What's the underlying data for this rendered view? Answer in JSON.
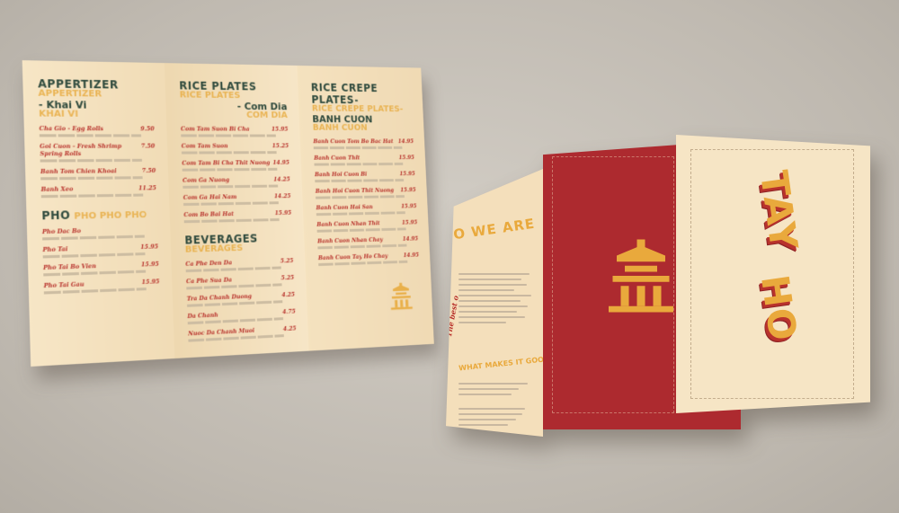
{
  "inside": {
    "panel1": {
      "heading": "APPERTIZER",
      "echo": "APPERTIZER",
      "subheading": "- Khai Vi",
      "sub_echo": "KHAI VI",
      "items": [
        {
          "name": "Cha Gio - Egg Rolls",
          "price": "9.50"
        },
        {
          "name": "Goi Cuon - Fresh Shrimp Spring Rolls",
          "price": "7.50"
        },
        {
          "name": "Banh Tom Chien Khoai",
          "price": "7.50"
        },
        {
          "name": "Banh Xeo",
          "price": "11.25"
        }
      ],
      "pho_heading": "PHO",
      "pho_echo": "PHO PHO PHO",
      "pho_items": [
        {
          "name": "Pho Dac Bo",
          "price": ""
        },
        {
          "name": "Pho Tai",
          "price": "15.95"
        },
        {
          "name": "Pho Tai Bo Vien",
          "price": "15.95"
        },
        {
          "name": "Pho Tai Gau",
          "price": "15.95"
        }
      ]
    },
    "panel2": {
      "heading": "RICE PLATES",
      "echo": "RICE PLATES",
      "subheading": "- Com Dia",
      "sub_echo": "COM DIA",
      "items": [
        {
          "name": "Com Tam Suon Bi Cha",
          "price": "15.95"
        },
        {
          "name": "Com Tam Suon",
          "price": "15.25"
        },
        {
          "name": "Com Tam Bi Cha Thit Nuong",
          "price": "14.95"
        },
        {
          "name": "Com Ga Nuong",
          "price": "14.25"
        },
        {
          "name": "Com Ga Hai Nam",
          "price": "14.25"
        },
        {
          "name": "Com Bo Bai Hat",
          "price": "15.95"
        }
      ],
      "bev_heading": "BEVERAGES",
      "bev_echo": "BEVERAGES",
      "bev_items": [
        {
          "name": "Ca Phe Den Da",
          "price": "5.25"
        },
        {
          "name": "Ca Phe Sua Da",
          "price": "5.25"
        },
        {
          "name": "Tra Da Chanh Duong",
          "price": "4.25"
        },
        {
          "name": "Da Chanh",
          "price": "4.75"
        },
        {
          "name": "Nuoc Da Chanh Muoi",
          "price": "4.25"
        }
      ]
    },
    "panel3": {
      "heading": "RICE CREPE PLATES-",
      "echo": "RICE CREPE PLATES-",
      "subheading": "BANH CUON",
      "sub_echo": "BANH CUON",
      "items": [
        {
          "name": "Banh Cuon Tom Bo Bac Hat",
          "price": "14.95"
        },
        {
          "name": "Banh Cuon Thit",
          "price": "15.95"
        },
        {
          "name": "Banh Hoi Cuon Bi",
          "price": "15.95"
        },
        {
          "name": "Banh Hoi Cuon Thit Nuong",
          "price": "15.95"
        },
        {
          "name": "Banh Cuon Hai San",
          "price": "15.95"
        },
        {
          "name": "Banh Cuon Nhan Thit",
          "price": "15.95"
        },
        {
          "name": "Banh Cuon Nhan Chay",
          "price": "14.95"
        },
        {
          "name": "Banh Cuon Tay Ho Chay",
          "price": "14.95"
        }
      ]
    }
  },
  "outside": {
    "who_title": "O WE ARE",
    "good_title": "WHAT MAKES IT GOOD?",
    "side_tag": "The best o",
    "brand_word1": "TAY",
    "brand_word2": "HO"
  },
  "colors": {
    "paper": "#f6e4c3",
    "red": "#ad2a2f",
    "mustard": "#e9a93c",
    "green": "#2f4a3d",
    "item_red": "#b8322c"
  },
  "icons": [
    "pagoda-logo-icon"
  ]
}
